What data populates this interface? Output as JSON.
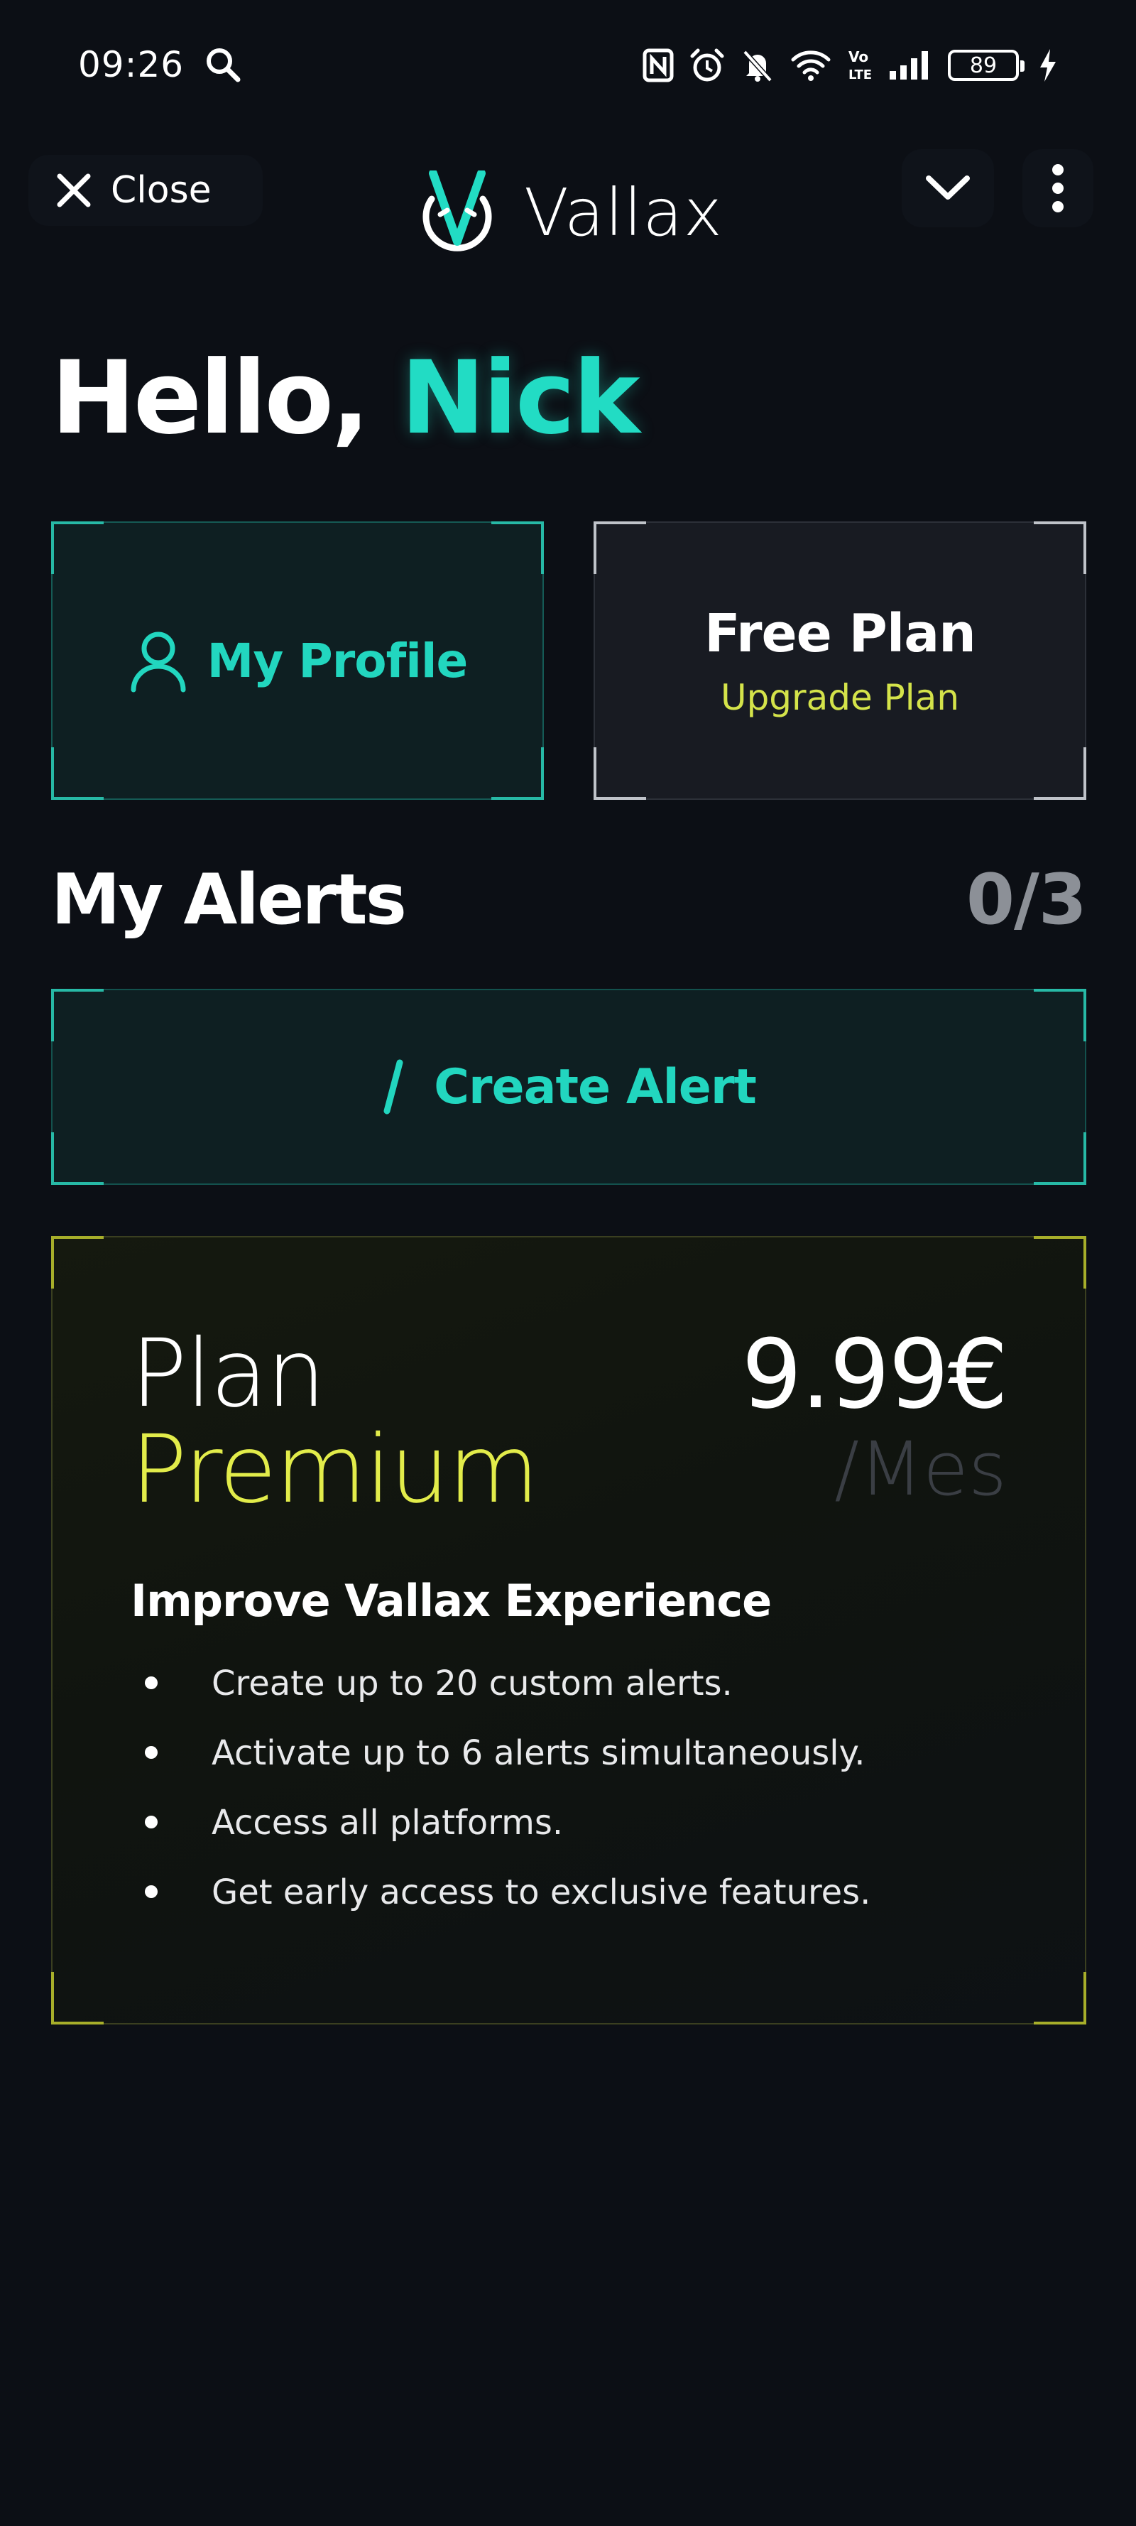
{
  "status_bar": {
    "time": "09:26",
    "battery": "89",
    "icons": [
      "search-icon",
      "nfc-icon",
      "alarm-icon",
      "mute-icon",
      "wifi-icon",
      "volte-icon",
      "signal-icon",
      "battery-icon",
      "charging-icon"
    ]
  },
  "header": {
    "close_label": "Close",
    "brand_name": "Vallax"
  },
  "greeting": {
    "prefix": "Hello,",
    "name": "Nick"
  },
  "profile_card": {
    "label": "My Profile"
  },
  "plan_card": {
    "title": "Free Plan",
    "upgrade_label": "Upgrade Plan"
  },
  "alerts": {
    "title": "My Alerts",
    "count": "0/3",
    "create_label": "Create Alert"
  },
  "premium": {
    "plan_word": "Plan",
    "tier": "Premium",
    "price": "9.99€",
    "period": "/Mes",
    "heading": "Improve Vallax Experience",
    "features": [
      "Create up to 20 custom alerts.",
      "Activate up to 6 alerts simultaneously.",
      "Access all platforms.",
      "Get early access to exclusive features."
    ]
  },
  "colors": {
    "accent_teal": "#22dcc4",
    "accent_yellow": "#e2ec4a",
    "background": "#0c0f15"
  }
}
